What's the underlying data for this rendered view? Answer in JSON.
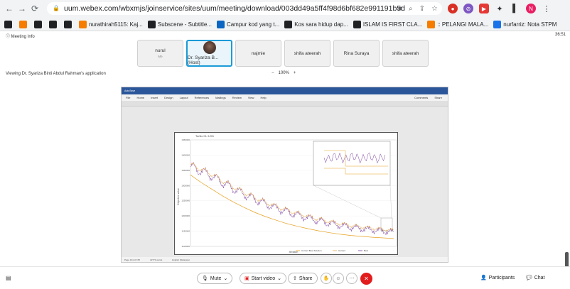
{
  "browser": {
    "url": "uum.webex.com/wbxmjs/joinservice/sites/uum/meeting/download/003dd49a5ff4f98d6bf682e991191b5d",
    "profile_initial": "N"
  },
  "bookmarks": [
    {
      "label": "",
      "color": "#202124"
    },
    {
      "label": "",
      "color": "#f57c00"
    },
    {
      "label": "",
      "color": "#202124"
    },
    {
      "label": "",
      "color": "#202124"
    },
    {
      "label": "",
      "color": "#202124"
    },
    {
      "label": "nurathirah5115: Kaj...",
      "color": "#f57c00"
    },
    {
      "label": "Subscene - Subtitle...",
      "color": "#202124"
    },
    {
      "label": "Campur kod yang t...",
      "color": "#0a66c2"
    },
    {
      "label": "Kos sara hidup dap...",
      "color": "#202124"
    },
    {
      "label": "ISLAM IS FIRST CLA...",
      "color": "#202124"
    },
    {
      "label": ":: PELANGI MALA...",
      "color": "#f57c00"
    },
    {
      "label": "nurfarriz: Nota STPM",
      "color": "#1a73e8"
    }
  ],
  "meeting": {
    "info_label": "Meeting Info",
    "timer": "36:51",
    "viewing_text": "Viewing Dr. Syariza Binti Abdul Rahman's application",
    "zoom_level": "100%",
    "zoom_minus": "−",
    "zoom_plus": "+"
  },
  "participants_tiles": [
    {
      "name": "nurul",
      "sub": "Me",
      "active": false
    },
    {
      "name": "Dr. Syariza B...  (Host)",
      "sub": "",
      "active": true
    },
    {
      "name": "najmie",
      "sub": "",
      "active": false
    },
    {
      "name": "shifa ateerah",
      "sub": "",
      "active": false
    },
    {
      "name": "Rina Suraya",
      "sub": "",
      "active": false
    },
    {
      "name": "shifa ateerah",
      "sub": "",
      "active": false
    }
  ],
  "word": {
    "title": "AutoSave",
    "menu": [
      "File",
      "Home",
      "Insert",
      "Design",
      "Layout",
      "References",
      "Mailings",
      "Review",
      "View",
      "Help"
    ],
    "comments": "Comments",
    "share": "Share",
    "status_page": "Page 134 of 155",
    "status_words": "32774 words",
    "status_lang": "English (Malaysia)",
    "chart_title": "TurNo Ht. 6.3%",
    "chart_xlabel": "Iteration",
    "legend": [
      "Current Best Solution",
      "Current",
      "Best"
    ]
  },
  "chart_data": {
    "type": "line",
    "title": "TurNo Ht. 6.3%",
    "xlabel": "Iteration",
    "ylabel": "Objective value",
    "ylim": [
      1100000,
      1450000
    ],
    "yticks": [
      1450000,
      1400000,
      1350000,
      1300000,
      1250000,
      1200000,
      1150000,
      1100000
    ],
    "series_colors": {
      "current": "#7b3fa0",
      "best": "#e6a020"
    },
    "series": [
      {
        "name": "Current",
        "values": [
          1362000,
          1348000,
          1331000,
          1310000,
          1290000,
          1272000,
          1255000,
          1240000,
          1226000,
          1214000,
          1203000,
          1193000,
          1184000,
          1176000,
          1169000,
          1163000,
          1158000,
          1154000,
          1150000,
          1147000
        ]
      },
      {
        "name": "Best",
        "values": [
          1335000,
          1310000,
          1288000,
          1266000,
          1246000,
          1228000,
          1212000,
          1198000,
          1186000,
          1175000,
          1166000,
          1158000,
          1151000,
          1145000,
          1140000,
          1136000,
          1133000,
          1130000,
          1128000,
          1126000
        ]
      }
    ]
  },
  "controls": {
    "mute": "Mute",
    "start_video": "Start video",
    "share": "Share",
    "participants": "Participants",
    "chat": "Chat"
  }
}
